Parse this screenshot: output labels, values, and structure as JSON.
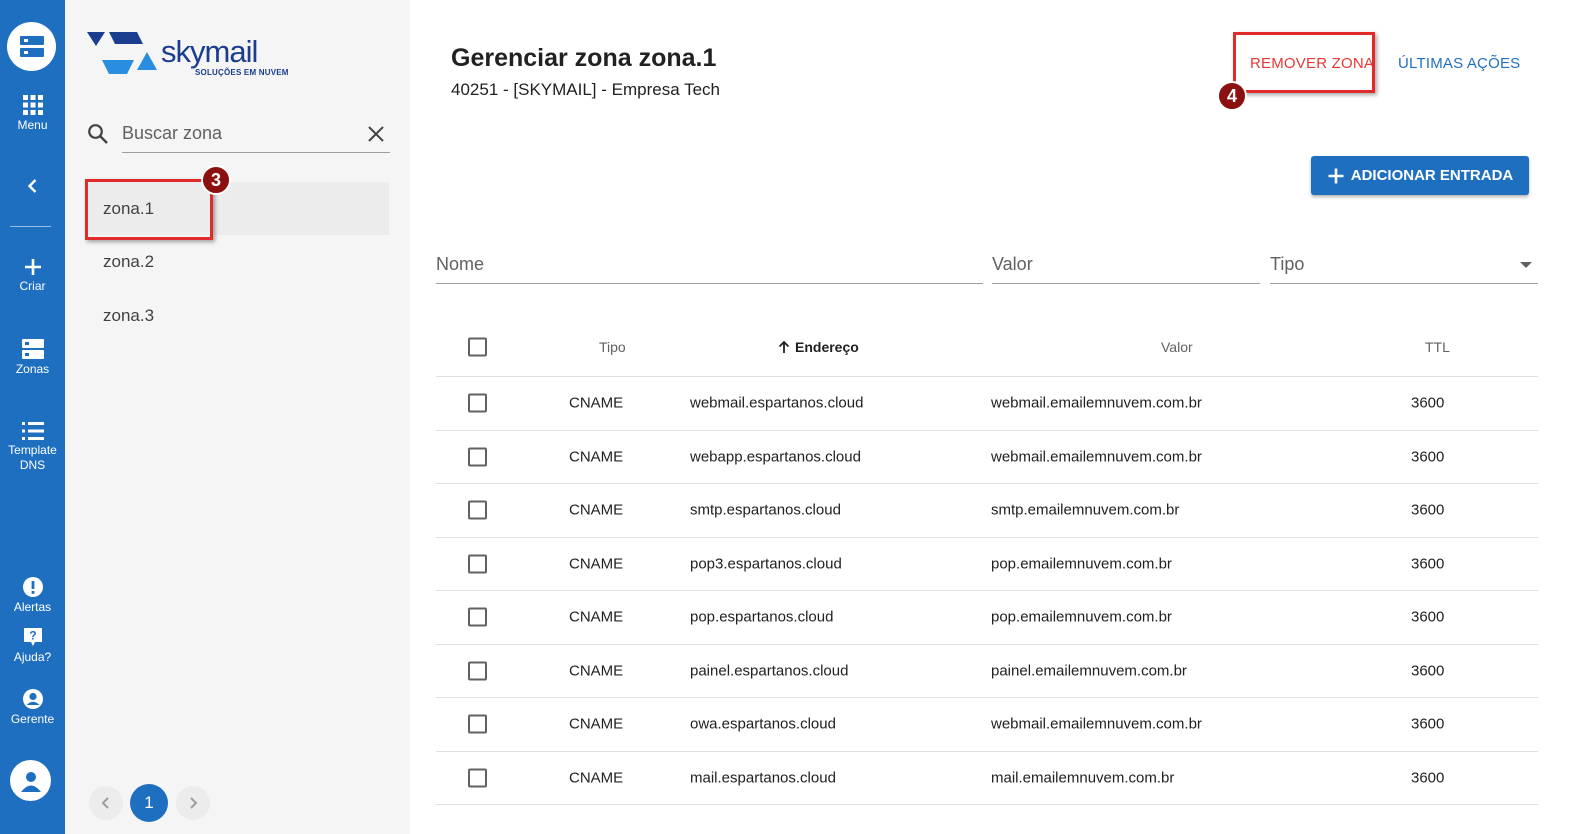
{
  "rail": {
    "items": [
      {
        "label": "Menu"
      },
      {
        "label": "Criar"
      },
      {
        "label": "Zonas"
      },
      {
        "label": "Template DNS"
      },
      {
        "label": "Alertas"
      },
      {
        "label": "Ajuda?"
      },
      {
        "label": "Gerente"
      }
    ]
  },
  "brand": {
    "name": "skymail",
    "tagline": "SOLUÇÕES EM NUVEM"
  },
  "search": {
    "placeholder": "Buscar zona",
    "value": ""
  },
  "zones": [
    {
      "name": "zona.1",
      "active": true
    },
    {
      "name": "zona.2",
      "active": false
    },
    {
      "name": "zona.3",
      "active": false
    }
  ],
  "pagination": {
    "current": "1"
  },
  "annotations": {
    "zone_badge": "3",
    "remove_badge": "4"
  },
  "header": {
    "title": "Gerenciar zona zona.1",
    "subtitle": "40251 - [SKYMAIL] - Empresa Tech",
    "remove_label": "REMOVER ZONA",
    "actions_label": "ÚLTIMAS AÇÕES",
    "add_label": "ADICIONAR ENTRADA"
  },
  "filters": {
    "name_placeholder": "Nome",
    "value_placeholder": "Valor",
    "type_placeholder": "Tipo"
  },
  "table": {
    "headers": {
      "tipo": "Tipo",
      "endereco": "Endereço",
      "valor": "Valor",
      "ttl": "TTL"
    },
    "rows": [
      {
        "tipo": "CNAME",
        "endereco": "webmail.espartanos.cloud",
        "valor": "webmail.emailemnuvem.com.br",
        "ttl": "3600"
      },
      {
        "tipo": "CNAME",
        "endereco": "webapp.espartanos.cloud",
        "valor": "webmail.emailemnuvem.com.br",
        "ttl": "3600"
      },
      {
        "tipo": "CNAME",
        "endereco": "smtp.espartanos.cloud",
        "valor": "smtp.emailemnuvem.com.br",
        "ttl": "3600"
      },
      {
        "tipo": "CNAME",
        "endereco": "pop3.espartanos.cloud",
        "valor": "pop.emailemnuvem.com.br",
        "ttl": "3600"
      },
      {
        "tipo": "CNAME",
        "endereco": "pop.espartanos.cloud",
        "valor": "pop.emailemnuvem.com.br",
        "ttl": "3600"
      },
      {
        "tipo": "CNAME",
        "endereco": "painel.espartanos.cloud",
        "valor": "painel.emailemnuvem.com.br",
        "ttl": "3600"
      },
      {
        "tipo": "CNAME",
        "endereco": "owa.espartanos.cloud",
        "valor": "webmail.emailemnuvem.com.br",
        "ttl": "3600"
      },
      {
        "tipo": "CNAME",
        "endereco": "mail.espartanos.cloud",
        "valor": "mail.emailemnuvem.com.br",
        "ttl": "3600"
      }
    ]
  },
  "colors": {
    "primary": "#1f6fc1",
    "danger": "#e53935",
    "badge": "#8b1010",
    "highlight": "#e12a2a"
  }
}
